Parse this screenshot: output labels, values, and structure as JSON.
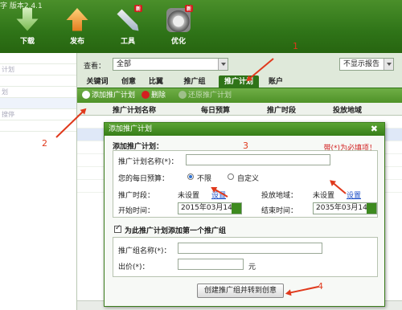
{
  "app_title": "字 版本2.4.1",
  "toolbar": [
    {
      "label": "下载",
      "icon": "download-icon"
    },
    {
      "label": "发布",
      "icon": "publish-icon"
    },
    {
      "label": "工具",
      "icon": "tools-icon",
      "badge": "新"
    },
    {
      "label": "优化",
      "icon": "optimize-icon",
      "badge": "新"
    }
  ],
  "left_tree": [
    "",
    "计划",
    "",
    "划",
    "",
    "搜停",
    ""
  ],
  "filter": {
    "view_label": "查看：",
    "view_value": "全部",
    "report_value": "不显示报告"
  },
  "tabs": [
    "关键词",
    "创意",
    "比翼",
    "推广组",
    "推广计划",
    "账户"
  ],
  "actions": {
    "add": "添加推广计划",
    "delete": "删除",
    "restore": "还原推广计划"
  },
  "grid_headers": [
    "推广计划名称",
    "每日预算",
    "推广时段",
    "投放地域"
  ],
  "dialog": {
    "title": "添加推广计划",
    "section1": "添加推广计划：",
    "required_note": "带(*)为必填项！",
    "name_label": "推广计划名称(*)：",
    "budget_label": "您的每日预算：",
    "budget_opt1": "不限",
    "budget_opt2": "自定义",
    "schedule_label": "推广时段：",
    "schedule_value": "未设置",
    "schedule_link": "设置",
    "region_label": "投放地域：",
    "region_value": "未设置",
    "region_link": "设置",
    "start_label": "开始时间：",
    "start_value": "2015年03月14日",
    "end_label": "结束时间：",
    "end_value": "2035年03月14日",
    "section2": "为此推广计划添加第一个推广组",
    "group_label": "推广组名称(*)：",
    "price_label": "出价(*)：",
    "price_unit": "元",
    "create_button": "创建推广组并转到创意"
  },
  "annotations": [
    "1",
    "2",
    "3",
    "4"
  ],
  "colors": {
    "brand_green": "#2f7418",
    "annotation_red": "#e0391c",
    "link_blue": "#1c4fc7"
  }
}
